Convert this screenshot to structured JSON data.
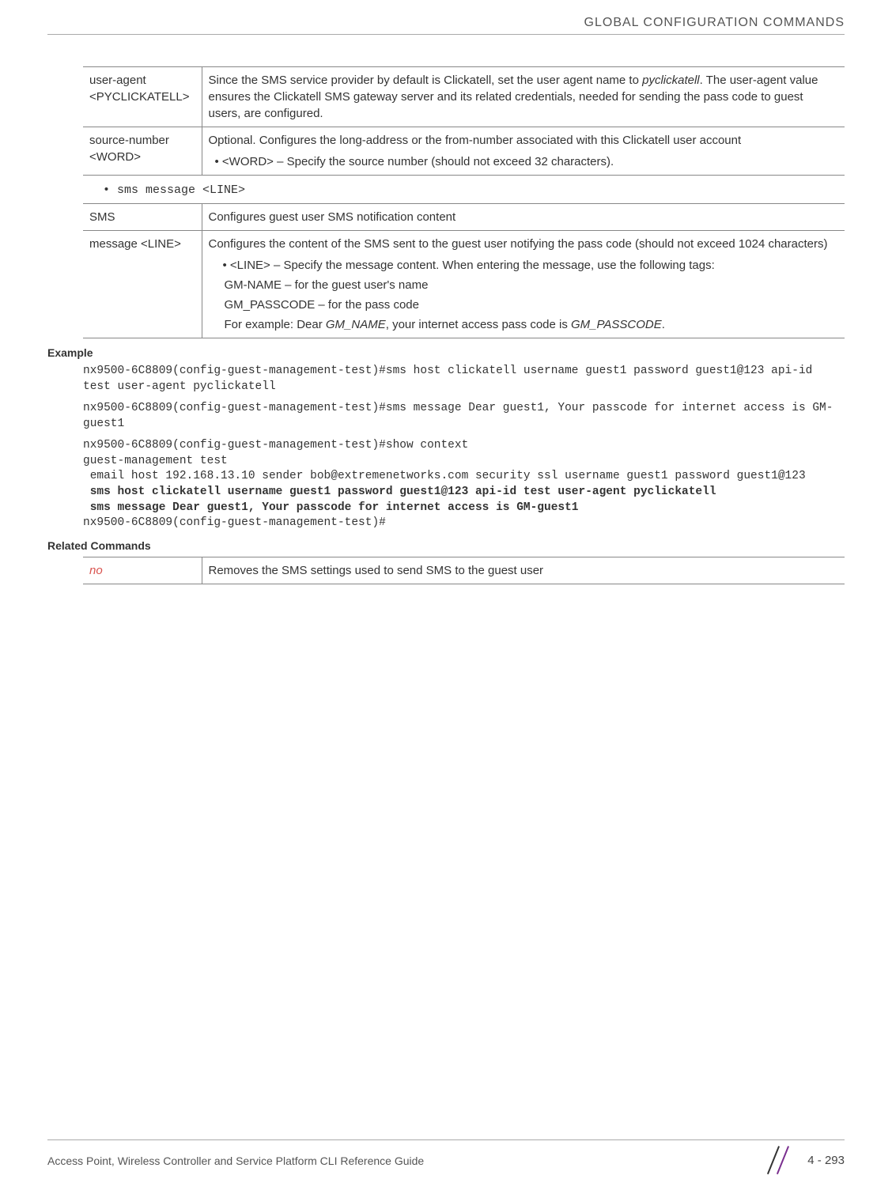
{
  "header": {
    "title": "GLOBAL CONFIGURATION COMMANDS"
  },
  "table1": {
    "row1": {
      "param": "user-agent <PYCLICKATELL>",
      "desc_pre": "Since the SMS service provider by default is Clickatell, set the user agent name to ",
      "desc_italic": "pyclickatell",
      "desc_post": ". The user-agent value ensures the Clickatell SMS gateway server and its related credentials, needed for sending the pass code to guest users, are configured."
    },
    "row2": {
      "param": "source-number <WORD>",
      "desc_line1": "Optional. Configures the long-address or the from-number associated with this Clickatell user account",
      "desc_bullet": "• <WORD> – Specify the source number (should not exceed 32 characters)."
    }
  },
  "bullet1": "sms message <LINE>",
  "table2": {
    "row1": {
      "param": "SMS",
      "desc": "Configures guest user SMS notification content"
    },
    "row2": {
      "param": "message <LINE>",
      "desc_line1": "Configures the content of the SMS sent to the guest user notifying the pass code (should not exceed 1024 characters)",
      "bullet": "• <LINE> – Specify the message content. When entering the message, use the following tags:",
      "sub1": "GM-NAME – for the guest user's name",
      "sub2": "GM_PASSCODE – for the pass code",
      "sub3_pre": "For example: Dear ",
      "sub3_i1": "GM_NAME",
      "sub3_mid": ", your internet access pass code is ",
      "sub3_i2": "GM_PASSCODE",
      "sub3_post": "."
    }
  },
  "example_heading": "Example",
  "code": {
    "line1": "nx9500-6C8809(config-guest-management-test)#sms host clickatell username guest1 password guest1@123 api-id test user-agent pyclickatell",
    "line2": "nx9500-6C8809(config-guest-management-test)#sms message Dear guest1, Your passcode for internet access is GM-guest1",
    "line3": "nx9500-6C8809(config-guest-management-test)#show context",
    "line4": "guest-management test",
    "line5": " email host 192.168.13.10 sender bob@extremenetworks.com security ssl username guest1 password guest1@123",
    "line6": " sms host clickatell username guest1 password guest1@123 api-id test user-agent pyclickatell",
    "line7": " sms message Dear guest1, Your passcode for internet access is GM-guest1",
    "line8": "nx9500-6C8809(config-guest-management-test)#"
  },
  "related_heading": "Related Commands",
  "table3": {
    "row1": {
      "param": "no",
      "desc": "Removes the SMS settings used to send SMS to the guest user"
    }
  },
  "footer": {
    "left": "Access Point, Wireless Controller and Service Platform CLI Reference Guide",
    "page": "4 - 293"
  }
}
